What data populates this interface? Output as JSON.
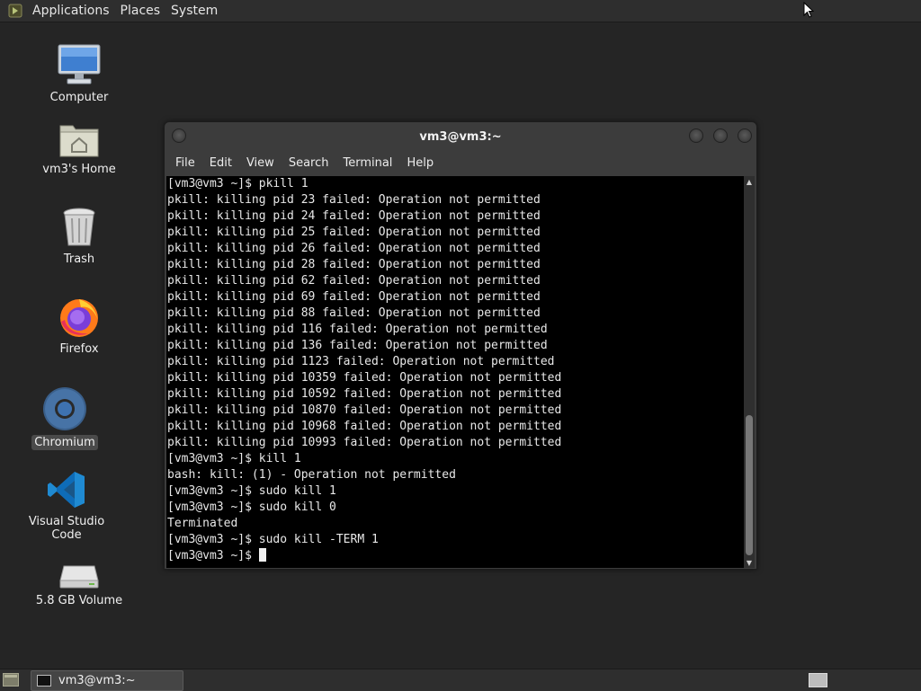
{
  "top_panel": {
    "menus": [
      "Applications",
      "Places",
      "System"
    ]
  },
  "desktop_icons": [
    {
      "label": "Computer",
      "icon": "computer-icon"
    },
    {
      "label": "vm3's Home",
      "icon": "home-folder-icon"
    },
    {
      "label": "Trash",
      "icon": "trash-icon"
    },
    {
      "label": "Firefox",
      "icon": "firefox-icon"
    },
    {
      "label": "Chromium",
      "icon": "chromium-icon",
      "selected": true
    },
    {
      "label": "Visual Studio Code",
      "icon": "vscode-icon"
    },
    {
      "label": "5.8 GB Volume",
      "icon": "drive-icon"
    }
  ],
  "terminal": {
    "title": "vm3@vm3:~",
    "menu": [
      "File",
      "Edit",
      "View",
      "Search",
      "Terminal",
      "Help"
    ],
    "lines": [
      "[vm3@vm3 ~]$ pkill 1",
      "pkill: killing pid 23 failed: Operation not permitted",
      "pkill: killing pid 24 failed: Operation not permitted",
      "pkill: killing pid 25 failed: Operation not permitted",
      "pkill: killing pid 26 failed: Operation not permitted",
      "pkill: killing pid 28 failed: Operation not permitted",
      "pkill: killing pid 62 failed: Operation not permitted",
      "pkill: killing pid 69 failed: Operation not permitted",
      "pkill: killing pid 88 failed: Operation not permitted",
      "pkill: killing pid 116 failed: Operation not permitted",
      "pkill: killing pid 136 failed: Operation not permitted",
      "pkill: killing pid 1123 failed: Operation not permitted",
      "pkill: killing pid 10359 failed: Operation not permitted",
      "pkill: killing pid 10592 failed: Operation not permitted",
      "pkill: killing pid 10870 failed: Operation not permitted",
      "pkill: killing pid 10968 failed: Operation not permitted",
      "pkill: killing pid 10993 failed: Operation not permitted",
      "[vm3@vm3 ~]$ kill 1",
      "bash: kill: (1) - Operation not permitted",
      "[vm3@vm3 ~]$ sudo kill 1",
      "[vm3@vm3 ~]$ sudo kill 0",
      "Terminated",
      "[vm3@vm3 ~]$ sudo kill -TERM 1"
    ],
    "prompt": "[vm3@vm3 ~]$ "
  },
  "taskbar": {
    "task_label": "vm3@vm3:~"
  },
  "colors": {
    "desktop_bg": "#252525",
    "panel_bg": "#2e2e2e",
    "terminal_bg": "#000000",
    "terminal_fg": "#e8e8e8"
  }
}
